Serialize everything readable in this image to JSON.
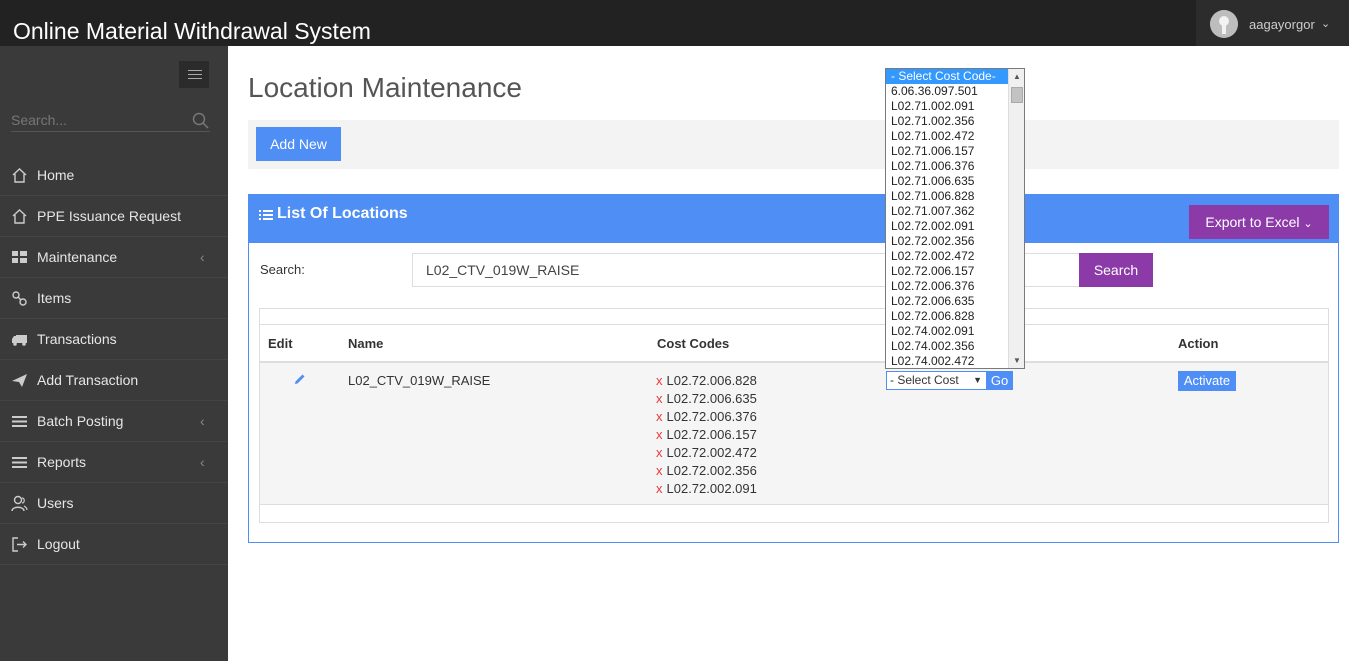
{
  "app": {
    "title": "Online Material Withdrawal System",
    "user_name": "aagayorgor"
  },
  "sidebar": {
    "search_placeholder": "Search...",
    "items": [
      {
        "label": "Home",
        "icon": "home-icon"
      },
      {
        "label": "PPE Issuance Request",
        "icon": "home-icon"
      },
      {
        "label": "Maintenance",
        "icon": "grid-icon",
        "has_children": true
      },
      {
        "label": "Items",
        "icon": "link-icon"
      },
      {
        "label": "Transactions",
        "icon": "truck-icon"
      },
      {
        "label": "Add Transaction",
        "icon": "paper-plane-icon"
      },
      {
        "label": "Batch Posting",
        "icon": "list-icon",
        "has_children": true
      },
      {
        "label": "Reports",
        "icon": "list-icon",
        "has_children": true
      },
      {
        "label": "Users",
        "icon": "users-icon"
      },
      {
        "label": "Logout",
        "icon": "logout-icon"
      }
    ]
  },
  "main": {
    "page_title": "Location Maintenance",
    "add_new_label": "Add New",
    "panel": {
      "title": "List Of Locations",
      "export_label": "Export to Excel",
      "search_label": "Search:",
      "search_value": "L02_CTV_019W_RAISE",
      "search_button": "Search"
    },
    "table": {
      "headers": {
        "edit": "Edit",
        "name": "Name",
        "cost_codes": "Cost Codes",
        "action": "Action"
      },
      "rows": [
        {
          "name": "L02_CTV_019W_RAISE",
          "cost_codes": [
            "L02.72.006.828",
            "L02.72.006.635",
            "L02.72.006.376",
            "L02.72.006.157",
            "L02.72.002.472",
            "L02.72.002.356",
            "L02.72.002.091"
          ],
          "remove_mark": "x",
          "select_value": "- Select Cost",
          "go_label": "Go",
          "action_label": "Activate"
        }
      ]
    }
  },
  "dropdown": {
    "selected": "- Select Cost Code-",
    "options": [
      "- Select Cost Code-",
      "6.06.36.097.501",
      "L02.71.002.091",
      "L02.71.002.356",
      "L02.71.002.472",
      "L02.71.006.157",
      "L02.71.006.376",
      "L02.71.006.635",
      "L02.71.006.828",
      "L02.71.007.362",
      "L02.72.002.091",
      "L02.72.002.356",
      "L02.72.002.472",
      "L02.72.006.157",
      "L02.72.006.376",
      "L02.72.006.635",
      "L02.72.006.828",
      "L02.74.002.091",
      "L02.74.002.356",
      "L02.74.002.472"
    ]
  },
  "colors": {
    "accent_blue": "#4e8ef5",
    "accent_purple": "#8b3aa8",
    "sidebar_bg": "#3a3a3a",
    "topbar_bg": "#222222",
    "remove_red": "#e83838"
  }
}
